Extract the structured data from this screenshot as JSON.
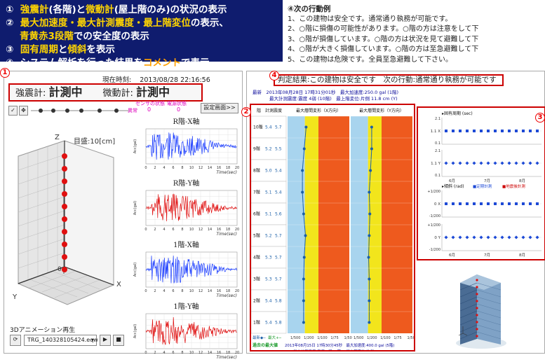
{
  "legend": {
    "row1": {
      "num": "①",
      "pre": "",
      "hl1": "強震計",
      "mid": "(各階)と",
      "hl2": "微動計",
      "post": "(屋上階のみ)の状況の表示"
    },
    "row2": {
      "num": "②",
      "pre": "",
      "hl1": "最大加速度・最大計測震度・最上階変位",
      "mid": "の表示、",
      "hl2": "",
      "post": ""
    },
    "row2b": {
      "hl1": "青黄赤3段階",
      "post": "での安全度の表示"
    },
    "row3": {
      "num": "③",
      "hl1": "固有周期",
      "mid": "と",
      "hl2": "傾斜",
      "post": "を表示"
    },
    "row4": {
      "num": "④",
      "pre": "システム解析を行った結果を",
      "hl1": "コメント",
      "post": "で表示"
    }
  },
  "actions": {
    "header": "④次の行動例",
    "items": [
      "1、この建物は安全です。通常通り執務が可能です。",
      "2、○階に損傷の可能性があります。○階の方は注意をして下",
      "3、○階が損傷しています。○階の方は状況を見て避難して下",
      "4、○階が大きく損傷しています。○階の方は至急避難して下",
      "5、この建物は危険です。全員至急避難して下さい。"
    ]
  },
  "markers": {
    "m1": "1",
    "m2": "2",
    "m3": "3",
    "m4": "4"
  },
  "left_panel": {
    "time_label": "現在時刻:",
    "time_value": "2013/08/28 22:16:56",
    "strong_label": "強震計:",
    "strong_value": "計測中",
    "micro_label": "微動計:",
    "micro_value": "計測中",
    "sensor_state": "センサの状態",
    "power_state": "電源状態",
    "abnormal": "異常",
    "sensor_val": "0",
    "power_val": "0",
    "settings_button": "設定画面>>",
    "scale_label": "目盛:10[cm]",
    "axis_z": "Z",
    "axis_x": "X",
    "axis_y": "Y",
    "axis_0": "0",
    "anim_label": "3Dアニメーション再生",
    "file_select": "TRG_140328105424.eqw",
    "waves": [
      {
        "title": "R階-X軸",
        "color": "#1a3cff"
      },
      {
        "title": "R階-Y軸",
        "color": "#e01010"
      },
      {
        "title": "1階-X軸",
        "color": "#1a3cff"
      },
      {
        "title": "1階-Y軸",
        "color": "#e01010"
      }
    ],
    "wave_xlabel": "Time(sec)",
    "wave_ylabel": "Acc(gal)",
    "wave_xticks": [
      "0",
      "2",
      "4",
      "6",
      "8",
      "10",
      "12",
      "14",
      "16",
      "18",
      "20"
    ]
  },
  "right_panel": {
    "judgement": "判定結果:この建物は安全です　次の行動:通常通り執務が可能です",
    "latest_line1": "最新　2013年08月28日 17時31分01秒　最大加速度:250.0 gal (1階)",
    "latest_line2": "最大計測震度:震度 4弱 (10階)　最上階変位:片側 11.8 cm (Y)",
    "col_floor": "階",
    "col_inst": "計測震度",
    "col_x": "最大層間変形（X方向）",
    "col_y": "最大層間変形（Y方向）",
    "floors": [
      "10階",
      "9階",
      "8階",
      "7階",
      "6階",
      "5階",
      "4階",
      "3階",
      "2階",
      "1階"
    ],
    "inst_a": [
      "5.4",
      "5.2",
      "5.0",
      "5.1",
      "5.1",
      "5.2",
      "5.3",
      "5.3",
      "5.4",
      "5.4"
    ],
    "inst_b": [
      "5.7",
      "5.5",
      "5.4",
      "5.4",
      "5.6",
      "5.7",
      "5.7",
      "5.7",
      "5.8",
      "5.8"
    ],
    "drift_x": [
      0.3,
      0.27,
      0.24,
      0.24,
      0.26,
      0.29,
      0.27,
      0.26,
      0.26,
      0.26
    ],
    "drift_y": [
      0.34,
      0.34,
      0.32,
      0.3,
      0.31,
      0.3,
      0.29,
      0.3,
      0.3,
      0.3
    ],
    "legend_latest": "最新",
    "legend_max": "最大",
    "scale_ticks": [
      "1/500",
      "1/200",
      "1/100",
      "1/75",
      "1/50"
    ],
    "past_label": "過去の最大値",
    "past_line1": "2013年08月15日 17時30分45秒　最大加速度:400.0 gal (5階)",
    "past_line2": "最大計測震度:震度 6弱 (1階)　最上階変位:片側 17.2 cm (Y)",
    "trend_title1": "固有周期 (sec)",
    "trend_title2": "傾斜 (rad)",
    "trend_legend1": "定期計測",
    "trend_legend2": "地震後計測",
    "trend_months": [
      "6月",
      "7月",
      "8月"
    ],
    "period_top": {
      "ymax": "2.1",
      "ymid": "1.1 X",
      "ymin": "0.1"
    },
    "period_bot": {
      "ymax": "2.1",
      "ymid": "1.1 Y",
      "ymin": "0.1"
    },
    "tilt_top": {
      "ymax": "+1/200",
      "ymid": "0 X",
      "ymin": "-1/200"
    },
    "tilt_bot": {
      "ymax": "+1/200",
      "ymid": "0 Y",
      "ymin": "-1/200"
    },
    "colors": {
      "blue": "#a8d4ee",
      "yellow": "#f2e51c",
      "red": "#ee5a1e",
      "accent": "#c00000"
    }
  }
}
